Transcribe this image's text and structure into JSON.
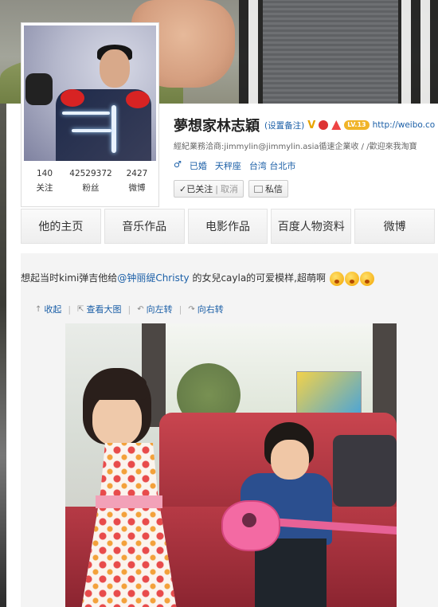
{
  "profile": {
    "name": "夢想家林志穎",
    "remark_link": "(设置备注)",
    "verified_badge": "V",
    "level_badge": "LV.13",
    "url": "http://weibo.co",
    "description": "經紀業務洽商:jimmylin@jimmylin.asia循速企業收 / /歡迎來我淘寶",
    "gender": "♂",
    "marital": "已婚",
    "zodiac": "天秤座",
    "location": "台湾 台北市",
    "follow_button": "✓已关注",
    "cancel_label": "取消",
    "message_button": "私信"
  },
  "stats": [
    {
      "value": "140",
      "label": "关注"
    },
    {
      "value": "42529372",
      "label": "粉丝"
    },
    {
      "value": "2427",
      "label": "微博"
    }
  ],
  "nav": {
    "tabs": [
      "他的主页",
      "音乐作品",
      "电影作品",
      "百度人物资料",
      "微博"
    ]
  },
  "post": {
    "text_before": "想起当时kimi弹吉他给",
    "mention": "@钟丽缇Christy",
    "text_after": " 的女兒cayla的可爱模样,超萌啊",
    "toolbar": {
      "collapse": "收起",
      "view_large": "查看大图",
      "rotate_left": "向左转",
      "rotate_right": "向右转"
    }
  },
  "icons": {
    "collapse": "up-arrow-icon",
    "view_large": "external-link-icon",
    "rotate_left": "rotate-left-icon",
    "rotate_right": "rotate-right-icon",
    "message": "message-icon",
    "emoji": "shocked-face-emoji"
  },
  "colors": {
    "link": "#1b5fa7",
    "tab_bg": "#f2f2f2"
  }
}
